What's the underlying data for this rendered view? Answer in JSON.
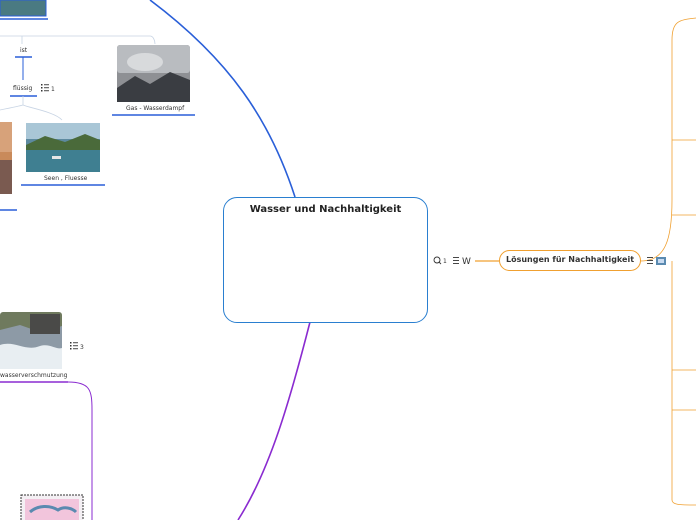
{
  "central": {
    "title": "Wasser und  Nachhaltigkeit"
  },
  "central_markers": {
    "comment_count": "1",
    "link_symbol": "W"
  },
  "solution": {
    "title": "Lösungen für Nachhaltigkeit"
  },
  "nodes": {
    "ist": "ist",
    "fluessig": "flüssig",
    "fluessig_count": "1",
    "gas": "Gas - Wasserdampf",
    "seen": "Seen , Fluesse",
    "verschmutzung": "wasserverschmutzung",
    "verschmutzung_count": "3"
  },
  "colors": {
    "blue_branch": "#2a5fd8",
    "purple_branch": "#8a2bd0",
    "orange_branch": "#f0a030",
    "central_border": "#2a7fd0"
  }
}
